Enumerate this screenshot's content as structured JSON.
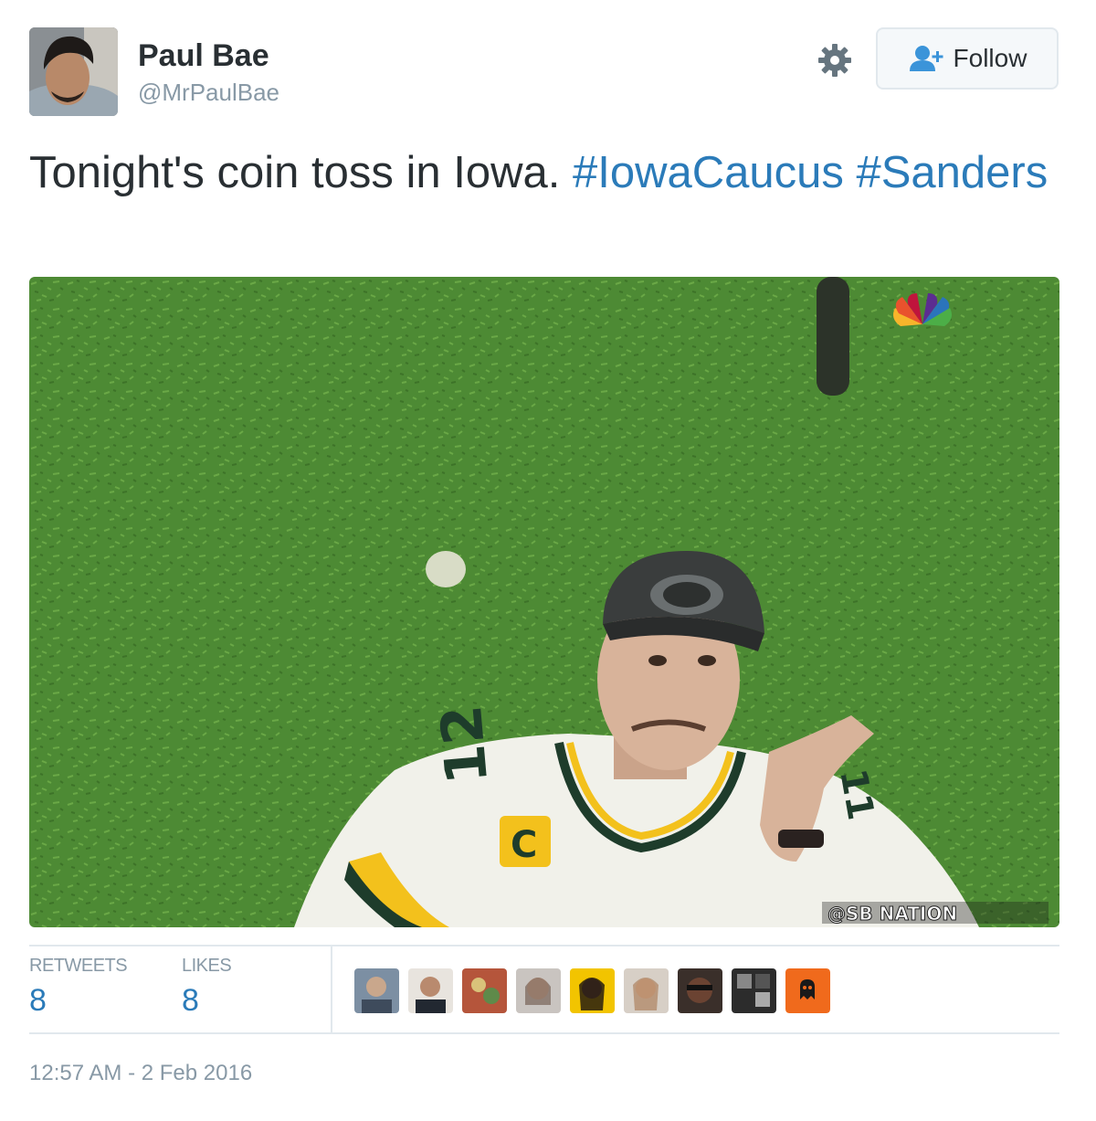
{
  "author": {
    "name": "Paul Bae",
    "handle": "@MrPaulBae"
  },
  "actions": {
    "follow_label": "Follow"
  },
  "tweet": {
    "text": "Tonight's coin toss in Iowa.",
    "hashtags": [
      "#IowaCaucus",
      "#Sanders"
    ]
  },
  "media": {
    "watermark": "@SB NATION"
  },
  "stats": {
    "retweets_label": "RETWEETS",
    "retweets_count": "8",
    "likes_label": "LIKES",
    "likes_count": "8"
  },
  "timestamp": "12:57 AM - 2 Feb 2016",
  "colors": {
    "link": "#2b7bb9",
    "muted": "#8899a6",
    "text": "#292f33"
  }
}
